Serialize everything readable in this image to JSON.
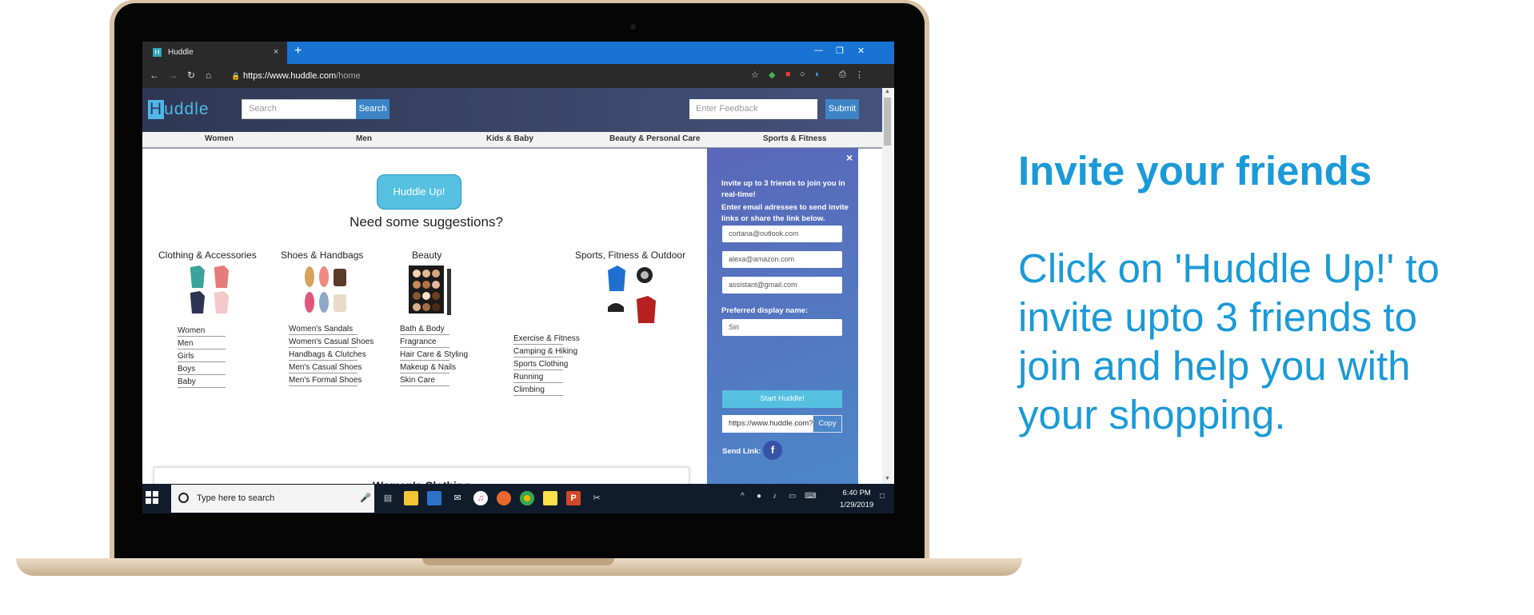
{
  "browser": {
    "tab_title": "Huddle",
    "tab_favicon": "H",
    "tab_close": "×",
    "new_tab": "+",
    "url_main": "https://www.huddle.com",
    "url_path": "/home"
  },
  "site": {
    "logo_h": "H",
    "logo_rest": "uddle",
    "search_placeholder": "Search",
    "search_button": "Search",
    "feedback_placeholder": "Enter Feedback",
    "submit_button": "Submit",
    "categories": [
      "Women",
      "Men",
      "Kids & Baby",
      "Beauty & Personal Care",
      "Sports & Fitness"
    ]
  },
  "main": {
    "huddle_button": "Huddle Up!",
    "suggest_title": "Need some suggestions?",
    "columns": [
      {
        "title": "Clothing & Accessories",
        "links": [
          "Women",
          "Men",
          "Girls",
          "Boys",
          "Baby"
        ]
      },
      {
        "title": "Shoes & Handbags",
        "links": [
          "Women's Sandals",
          "Women's Casual Shoes",
          "Handbags & Clutches",
          "Men's Casual Shoes",
          "Men's Formal Shoes"
        ]
      },
      {
        "title": "Beauty",
        "links": [
          "Bath & Body",
          "Fragrance",
          "Hair Care & Styling",
          "Makeup & Nails",
          "Skin Care"
        ]
      },
      {
        "title": "Sports, Fitness & Outdoor",
        "links": [
          "Exercise & Fitness",
          "Camping & Hiking",
          "Sports Clothing",
          "Running",
          "Climbing"
        ]
      }
    ],
    "card_title": "Women's Clothing"
  },
  "invite_panel": {
    "close": "×",
    "intro": "Invite up to 3 friends to join you in real-time!",
    "instructions": "Enter email adresses to send invite links or share the link below.",
    "emails": [
      "cortana@outlook.com",
      "alexa@amazon.com",
      "assistant@gmail.com"
    ],
    "display_name_label": "Preferred display name:",
    "display_name": "Siri",
    "start_button": "Start Huddle!",
    "share_link": "https://www.huddle.com?r",
    "copy_button": "Copy",
    "send_link_label": "Send Link:",
    "facebook_glyph": "f"
  },
  "taskbar": {
    "search_placeholder": "Type here to search",
    "time": "6:40 PM",
    "date": "1/29/2019"
  },
  "promo": {
    "heading": "Invite your friends",
    "lines": [
      "Click on 'Huddle Up!' to",
      "invite upto 3 friends to",
      "join and help you with",
      "your shopping."
    ]
  },
  "icons": {
    "accent_color": "#1b9ad8",
    "panel_color": "#5a67b8",
    "button_color": "#56c0e0"
  }
}
